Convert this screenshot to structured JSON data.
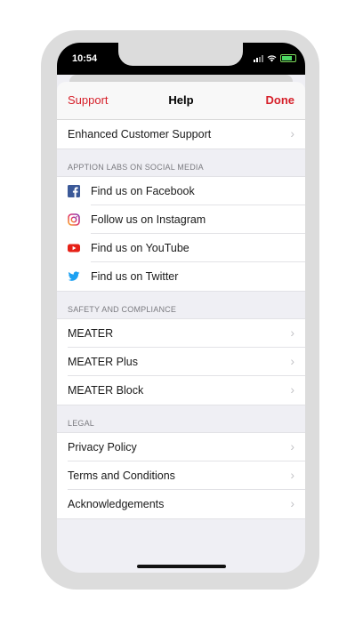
{
  "status_bar": {
    "time": "10:54"
  },
  "navbar": {
    "back_label": "Support",
    "title": "Help",
    "done_label": "Done"
  },
  "top_section": {
    "items": [
      {
        "label": "Enhanced Customer Support"
      }
    ]
  },
  "social_section": {
    "header": "APPTION LABS ON SOCIAL MEDIA",
    "items": [
      {
        "label": "Find us on Facebook",
        "icon": "facebook-icon"
      },
      {
        "label": "Follow us on Instagram",
        "icon": "instagram-icon"
      },
      {
        "label": "Find us on YouTube",
        "icon": "youtube-icon"
      },
      {
        "label": "Find us on Twitter",
        "icon": "twitter-icon"
      }
    ]
  },
  "safety_section": {
    "header": "SAFETY AND COMPLIANCE",
    "items": [
      {
        "label": "MEATER"
      },
      {
        "label": "MEATER Plus"
      },
      {
        "label": "MEATER Block"
      }
    ]
  },
  "legal_section": {
    "header": "LEGAL",
    "items": [
      {
        "label": "Privacy Policy"
      },
      {
        "label": "Terms and Conditions"
      },
      {
        "label": "Acknowledgements"
      }
    ]
  },
  "colors": {
    "accent": "#d6202a",
    "facebook": "#3b5998",
    "youtube": "#e62117",
    "twitter": "#1da1f2"
  }
}
